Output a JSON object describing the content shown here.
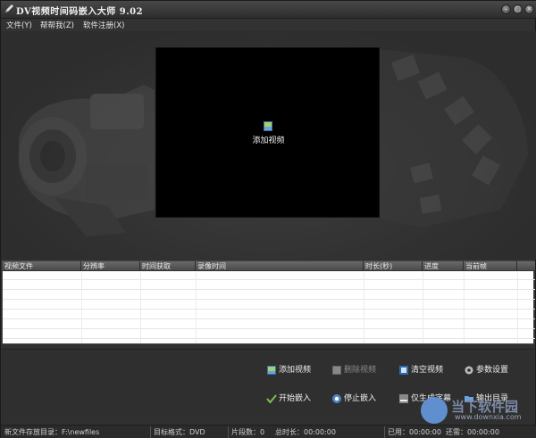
{
  "window": {
    "title": "DV视频时间码嵌入大师  9.02"
  },
  "menu": [
    "文件(Y)",
    "帮帮我(Z)",
    "软件注册(X)"
  ],
  "preview": {
    "label": "添加视频"
  },
  "table": {
    "columns": [
      "视频文件",
      "分辨率",
      "时间获取",
      "录像时间",
      "时长(秒)",
      "进度",
      "当前帧"
    ],
    "rows": []
  },
  "actions": {
    "add_video": "添加视频",
    "delete_video": "删除视频",
    "clear_video": "清空视频",
    "settings": "参数设置",
    "start_embed": "开始嵌入",
    "stop_embed": "停止嵌入",
    "generate_subtitle": "仅生成字幕",
    "output_dir": "输出目录"
  },
  "status": {
    "output_dir": "新文件存放目录：F:\\newfiles",
    "target_format": "目标格式：DVD",
    "segments": "片段数：0",
    "total_duration": "总时长：00:00:00",
    "used": "已用：00:00:00",
    "remaining": "还需：00:00:00"
  },
  "watermark": {
    "text": "当下软件园",
    "url": "www.downxia.com"
  },
  "colors": {
    "window_bg": "#323232",
    "preview_bg": "#000000",
    "table_bg": "#ffffff"
  }
}
